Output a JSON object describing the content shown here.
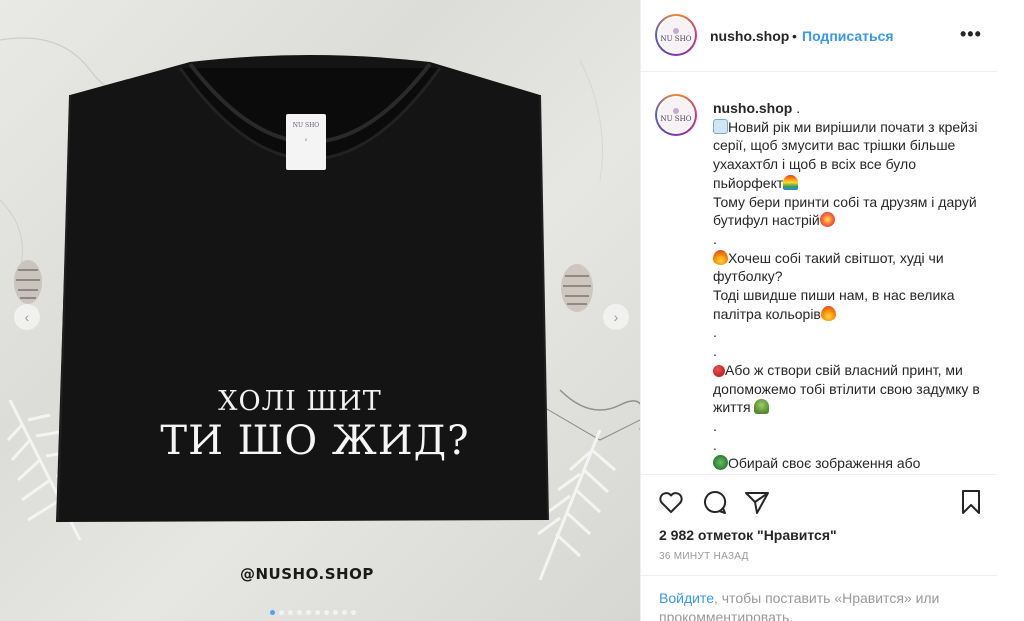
{
  "photo": {
    "shirt_line1": "ХОЛІ ШИТ",
    "shirt_line2": "ТИ ШО ЖИД?",
    "label_text": "NU SHO",
    "watermark": "@NUSHO.SHOP",
    "prev_icon": "chevron-left-icon",
    "next_icon": "chevron-right-icon",
    "dots_count": 10,
    "active_dot": 0
  },
  "header": {
    "username": "nusho.shop",
    "separator": "•",
    "follow_label": "Подписаться",
    "more_icon": "more-horizontal-icon",
    "avatar_logo": "NU SHO"
  },
  "caption": {
    "username": "nusho.shop",
    "user_suffix": " .",
    "lines": [
      {
        "emoji": "house",
        "text": "Новий рік ми вирішили почати з крейзі серії, щоб змусити вас трішки більше ухахахтбл і щоб в всіх все було пьйорфект",
        "emoji_after": "rainbow"
      },
      {
        "emoji": "",
        "text": "Тому бери принти собі та друзям і даруй бутифул настрій",
        "emoji_after": "boom"
      },
      {
        "emoji": "",
        "text": ".",
        "emoji_after": ""
      },
      {
        "emoji": "fire",
        "text": "Хочеш собі такий світшот, худі чи футболку?",
        "emoji_after": ""
      },
      {
        "emoji": "",
        "text": "Тоді швидше пиши нам, в нас велика палітра кольорів",
        "emoji_after": "fire"
      },
      {
        "emoji": "",
        "text": ".",
        "emoji_after": ""
      },
      {
        "emoji": "",
        "text": ".",
        "emoji_after": ""
      },
      {
        "emoji": "pin",
        "text": "Або ж створи свій власний принт, ми допоможемо тобі втілити свою задумку в життя ",
        "emoji_after": "sprout"
      },
      {
        "emoji": "",
        "text": ".",
        "emoji_after": ""
      },
      {
        "emoji": "",
        "text": ".",
        "emoji_after": ""
      },
      {
        "emoji": "clover",
        "text": "Обирай своє зображення або",
        "emoji_after": ""
      }
    ]
  },
  "actions": {
    "like_icon": "heart-icon",
    "comment_icon": "comment-icon",
    "share_icon": "share-icon",
    "save_icon": "bookmark-icon",
    "likes_text": "2 982 отметок \"Нравится\"",
    "timestamp": "36 МИНУТ НАЗАД",
    "login_link": "Войдите",
    "login_rest": ", чтобы поставить «Нравится» или прокомментировать."
  },
  "colors": {
    "accent": "#3897f0",
    "text": "#262626",
    "muted": "#999999",
    "border": "#efefef"
  }
}
